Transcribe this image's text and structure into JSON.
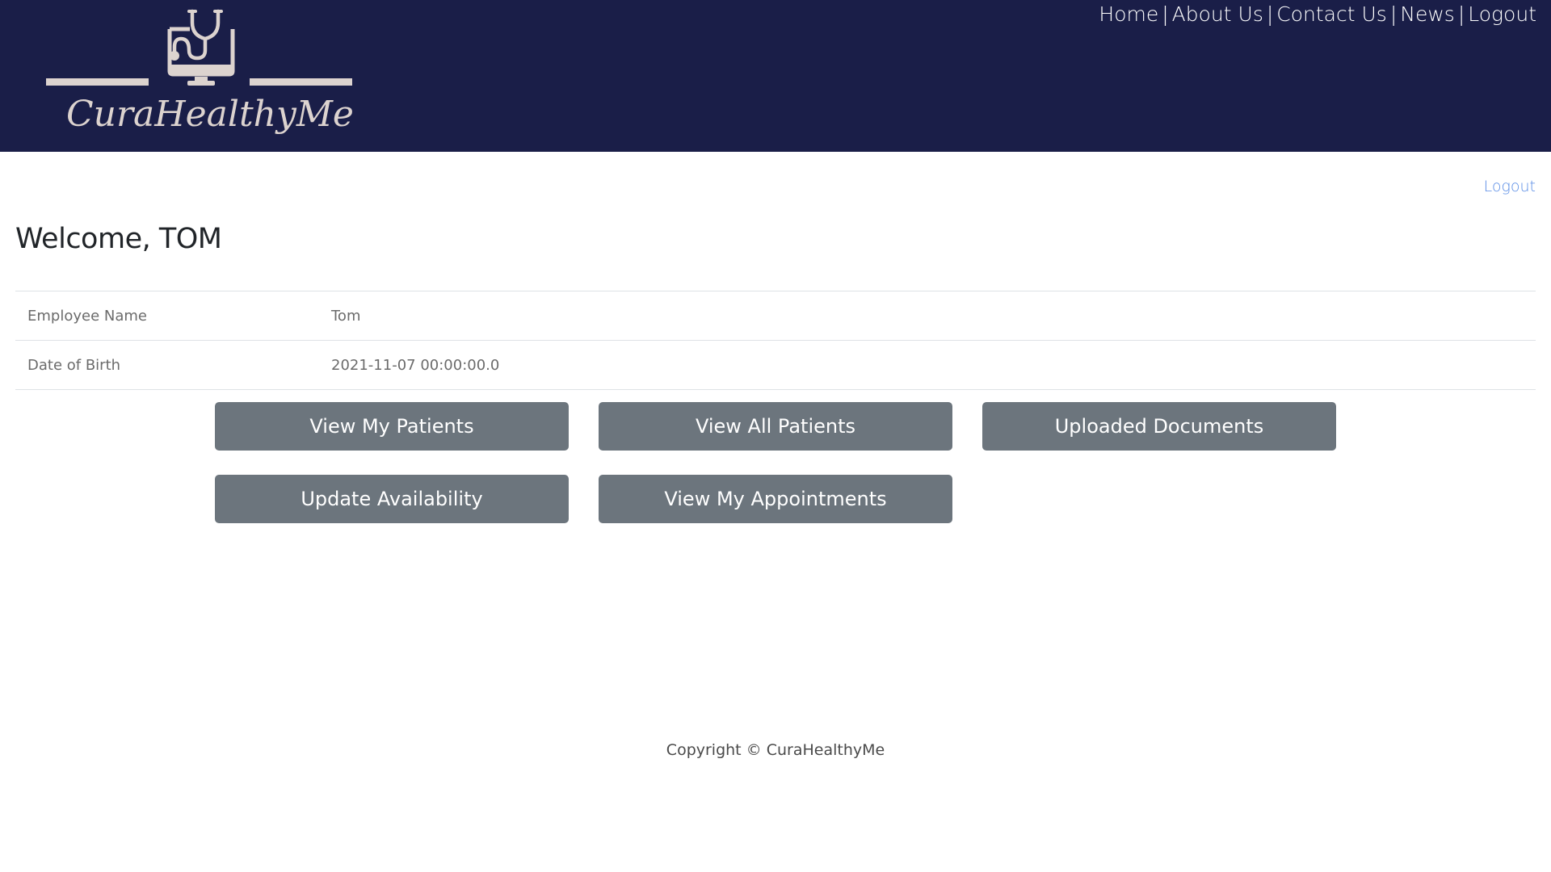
{
  "brand": {
    "name": "CuraHealthyMe",
    "logo_icon": "monitor-stethoscope-icon",
    "header_color": "#1a1e48",
    "logo_color": "#dcd3cf"
  },
  "nav": {
    "items": [
      {
        "label": "Home"
      },
      {
        "label": "About Us"
      },
      {
        "label": "Contact Us"
      },
      {
        "label": "News"
      },
      {
        "label": "Logout"
      }
    ],
    "separator": "|"
  },
  "main": {
    "logout_label": "Logout",
    "welcome": "Welcome, TOM",
    "details": [
      {
        "label": "Employee Name",
        "value": "Tom"
      },
      {
        "label": "Date of Birth",
        "value": "2021-11-07 00:00:00.0"
      }
    ],
    "actions": [
      {
        "label": "View My Patients"
      },
      {
        "label": "View All Patients"
      },
      {
        "label": "Uploaded Documents"
      },
      {
        "label": "Update Availability"
      },
      {
        "label": "View My Appointments"
      }
    ],
    "button_color": "#6c757d",
    "link_color": "#5b8ee6"
  },
  "footer": {
    "copyright": "Copyright © CuraHealthyMe"
  }
}
